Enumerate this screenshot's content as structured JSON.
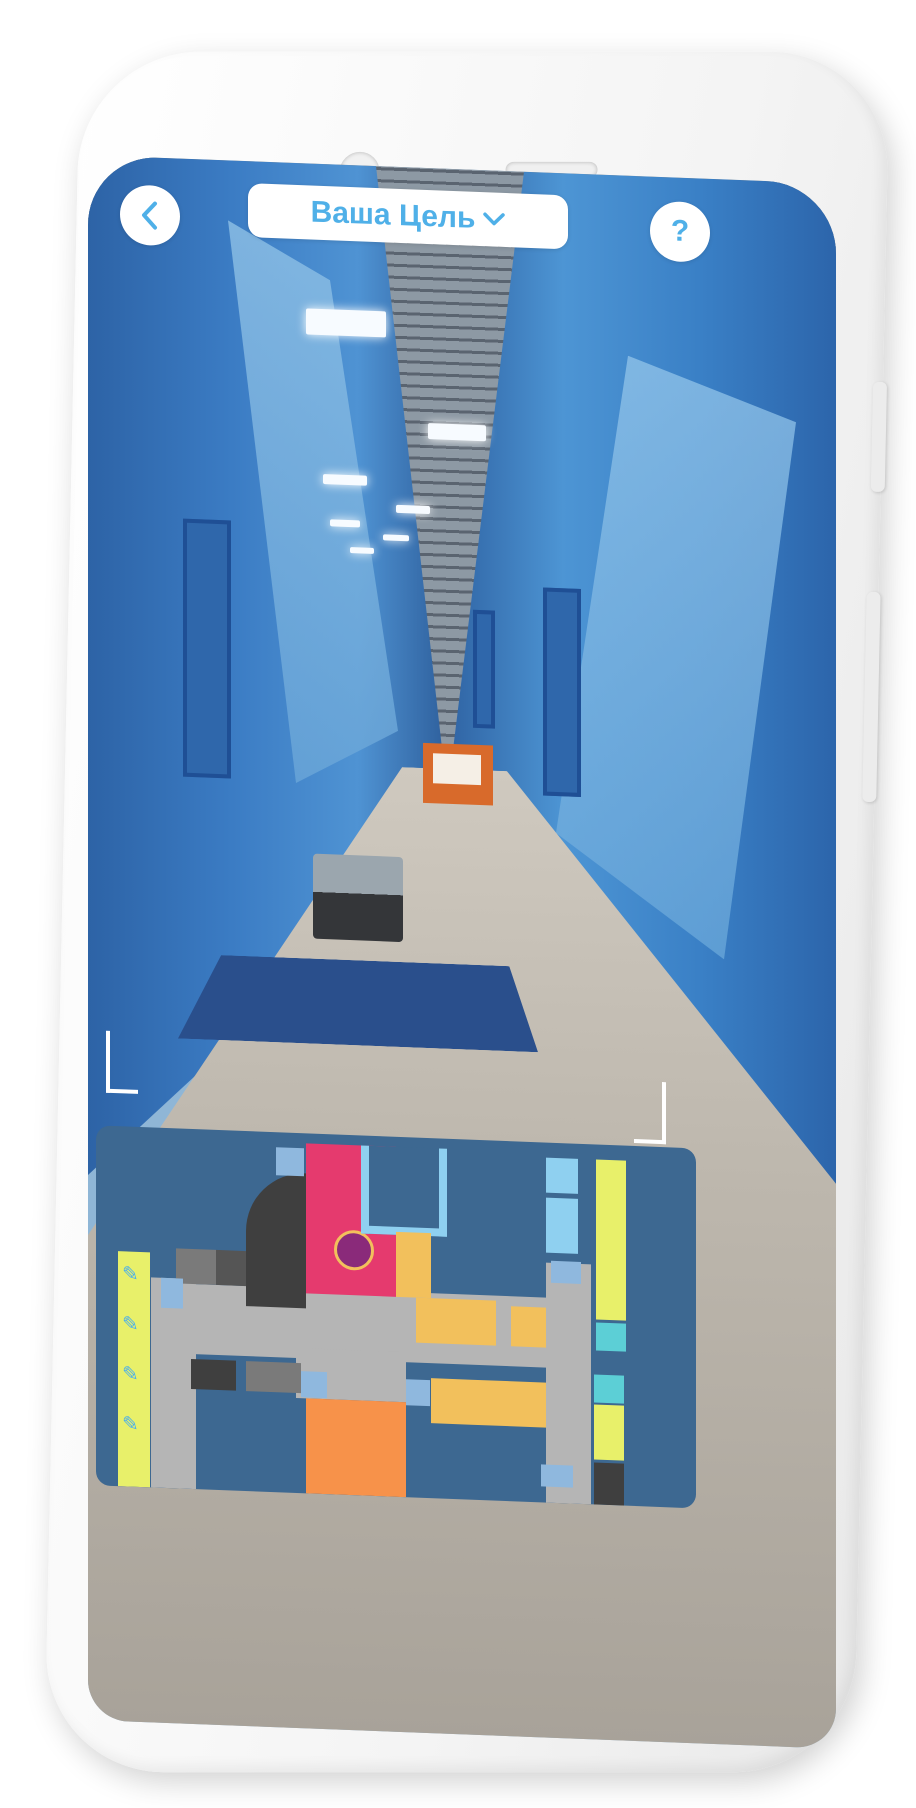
{
  "header": {
    "back_label": "Back",
    "target_label": "Ваша Цель",
    "help_label": "?"
  },
  "icons": {
    "back": "chevron-left-icon",
    "dropdown": "chevron-down-icon",
    "theatre": "theatre-masks-icon",
    "ruler": "ruler-pencil-icon",
    "stairs": "stairs-icon"
  },
  "colors": {
    "accent": "#4fb0e8",
    "map_bg": "#3d6891",
    "corridor": "#b5b5b5",
    "theatre_room": "#e53a6e",
    "rooms_orange": "#f2c05c",
    "rooms_yellow": "#e8f06a",
    "rooms_cyan": "#5ccfd6",
    "rooms_lightblue": "#8fd0f0",
    "rooms_dark": "#3f3f3f",
    "hall_orange": "#f7924a"
  }
}
